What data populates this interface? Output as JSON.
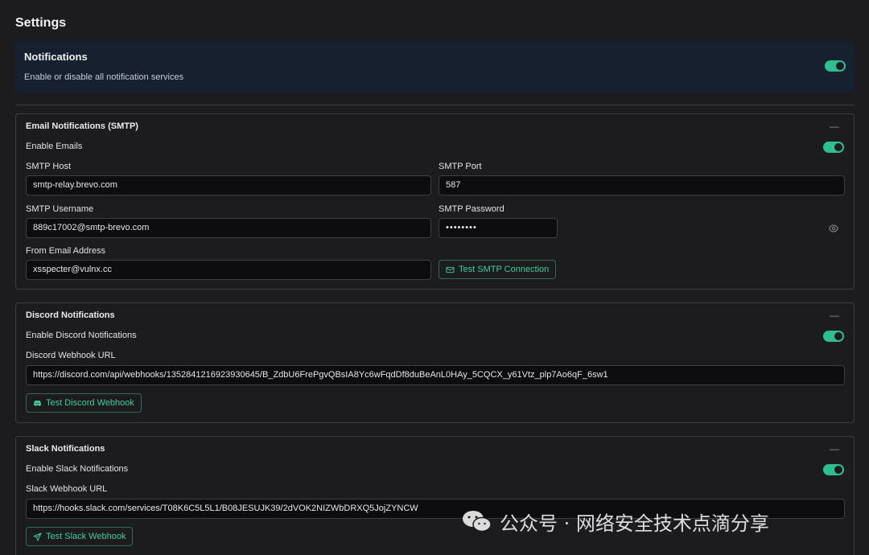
{
  "page": {
    "title": "Settings"
  },
  "notifications": {
    "title": "Notifications",
    "description": "Enable or disable all notification services",
    "enabled": true
  },
  "email": {
    "title": "Email Notifications (SMTP)",
    "collapse_symbol": "—",
    "enable_label": "Enable Emails",
    "enabled": true,
    "smtp_host_label": "SMTP Host",
    "smtp_host": "smtp-relay.brevo.com",
    "smtp_port_label": "SMTP Port",
    "smtp_port": "587",
    "smtp_username_label": "SMTP Username",
    "smtp_username": "889c17002@smtp-brevo.com",
    "smtp_password_label": "SMTP Password",
    "smtp_password_masked": "••••••••",
    "from_label": "From Email Address",
    "from_address": "xsspecter@vulnx.cc",
    "test_button": "Test SMTP Connection"
  },
  "discord": {
    "title": "Discord Notifications",
    "collapse_symbol": "—",
    "enable_label": "Enable Discord Notifications",
    "enabled": true,
    "webhook_label": "Discord Webhook URL",
    "webhook_url": "https://discord.com/api/webhooks/1352841216923930645/B_ZdbU6FrePgvQBsIA8Yc6wFqdDf8duBeAnL0HAy_5CQCX_y61Vtz_plp7Ao6qF_6sw1",
    "test_button": "Test Discord Webhook"
  },
  "slack": {
    "title": "Slack Notifications",
    "collapse_symbol": "—",
    "enable_label": "Enable Slack Notifications",
    "enabled": true,
    "webhook_label": "Slack Webhook URL",
    "webhook_url": "https://hooks.slack.com/services/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",
    "test_button": "Test Slack Webhook"
  },
  "watermark": {
    "text": "公众号 · 网络安全技术点滴分享"
  },
  "colors": {
    "accent": "#2fbe8f",
    "background": "#1c1c1e",
    "input_bg": "#0d0d0f",
    "banner_bg": "#16202e"
  }
}
